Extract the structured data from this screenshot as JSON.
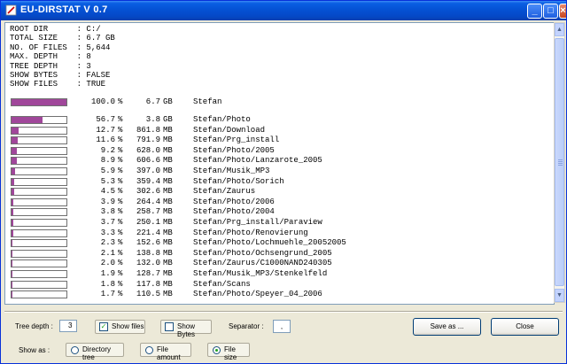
{
  "window": {
    "title": "EU-DIRSTAT V 0.7",
    "minimize": "_",
    "maximize": "□",
    "close": "×"
  },
  "info": [
    "ROOT DIR      : C:/",
    "TOTAL SIZE    : 6.7 GB",
    "NO. OF FILES  : 5,644",
    "MAX. DEPTH    : 8",
    "TREE DEPTH    : 3",
    "SHOW BYTES    : FALSE",
    "SHOW FILES    : TRUE"
  ],
  "root_entry": {
    "pct": "100.0",
    "size": "6.7",
    "unit": "GB",
    "path": "Stefan"
  },
  "entries": [
    {
      "pct": "56.7",
      "size": "3.8",
      "unit": "GB",
      "path": "Stefan/Photo"
    },
    {
      "pct": "12.7",
      "size": "861.8",
      "unit": "MB",
      "path": "Stefan/Download"
    },
    {
      "pct": "11.6",
      "size": "791.9",
      "unit": "MB",
      "path": "Stefan/Prg_install"
    },
    {
      "pct": "9.2",
      "size": "628.0",
      "unit": "MB",
      "path": "Stefan/Photo/2005"
    },
    {
      "pct": "8.9",
      "size": "606.6",
      "unit": "MB",
      "path": "Stefan/Photo/Lanzarote_2005"
    },
    {
      "pct": "5.9",
      "size": "397.0",
      "unit": "MB",
      "path": "Stefan/Musik_MP3"
    },
    {
      "pct": "5.3",
      "size": "359.4",
      "unit": "MB",
      "path": "Stefan/Photo/Sorich"
    },
    {
      "pct": "4.5",
      "size": "302.6",
      "unit": "MB",
      "path": "Stefan/Zaurus"
    },
    {
      "pct": "3.9",
      "size": "264.4",
      "unit": "MB",
      "path": "Stefan/Photo/2006"
    },
    {
      "pct": "3.8",
      "size": "258.7",
      "unit": "MB",
      "path": "Stefan/Photo/2004"
    },
    {
      "pct": "3.7",
      "size": "250.1",
      "unit": "MB",
      "path": "Stefan/Prg_install/Paraview"
    },
    {
      "pct": "3.3",
      "size": "221.4",
      "unit": "MB",
      "path": "Stefan/Photo/Renovierung"
    },
    {
      "pct": "2.3",
      "size": "152.6",
      "unit": "MB",
      "path": "Stefan/Photo/Lochmuehle_20052005"
    },
    {
      "pct": "2.1",
      "size": "138.8",
      "unit": "MB",
      "path": "Stefan/Photo/Ochsengrund_2005"
    },
    {
      "pct": "2.0",
      "size": "132.0",
      "unit": "MB",
      "path": "Stefan/Zaurus/C1000NAND240305"
    },
    {
      "pct": "1.9",
      "size": "128.7",
      "unit": "MB",
      "path": "Stefan/Musik_MP3/Stenkelfeld"
    },
    {
      "pct": "1.8",
      "size": "117.8",
      "unit": "MB",
      "path": "Stefan/Scans"
    },
    {
      "pct": "1.7",
      "size": "110.5",
      "unit": "MB",
      "path": "Stefan/Photo/Speyer_04_2006"
    }
  ],
  "controls": {
    "tree_depth_label": "Tree depth :",
    "tree_depth_value": "3",
    "show_files_label": "Show files",
    "show_files_checked": true,
    "show_bytes_label": "Show Bytes",
    "show_bytes_checked": false,
    "separator_label": "Separator :",
    "separator_value": ",",
    "save_label": "Save as ...",
    "close_label": "Close",
    "show_as_label": "Show as :",
    "radio_tree_label": "Directory tree",
    "radio_amount_label": "File amount",
    "radio_size_label": "File size",
    "selected_view": "File size"
  },
  "colors": {
    "bar_fill": "#a0479a",
    "titlebar": "#0553d6"
  }
}
